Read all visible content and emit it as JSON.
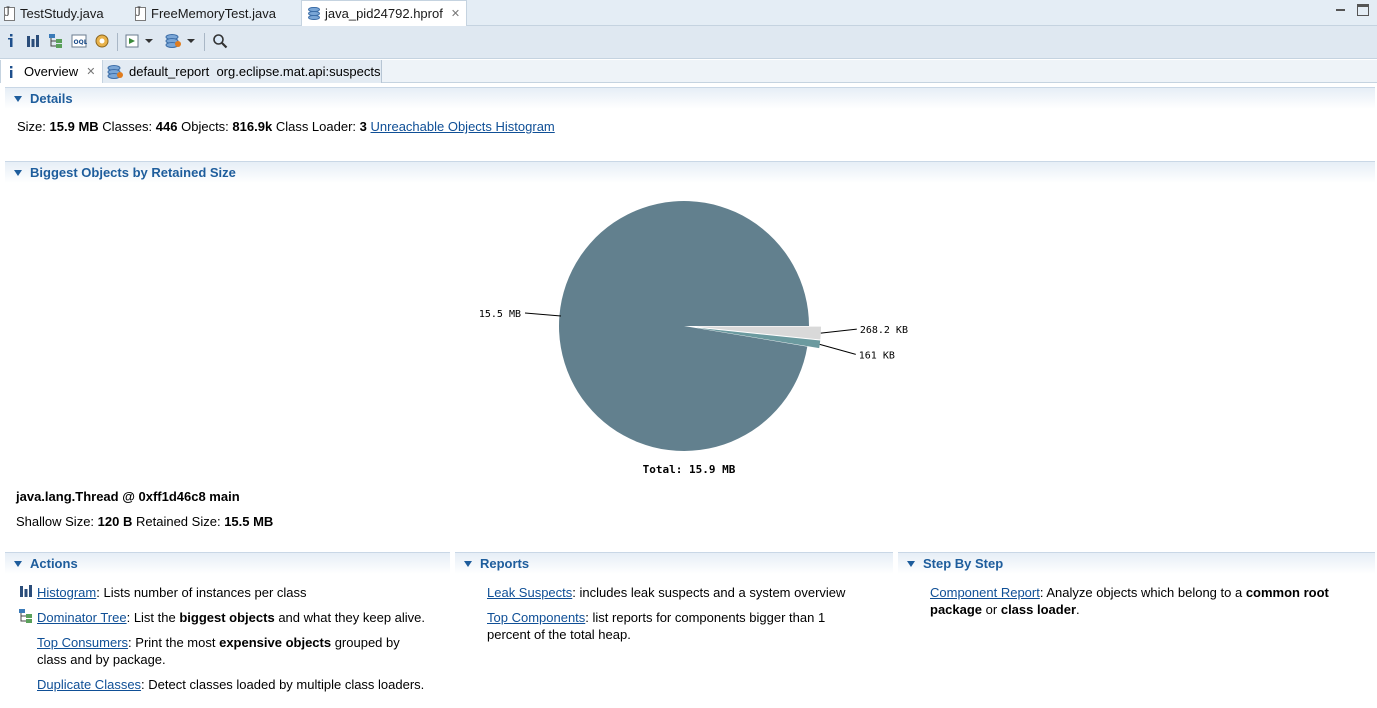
{
  "editor_tabs": [
    {
      "label": "TestStudy.java"
    },
    {
      "label": "FreeMemoryTest.java"
    },
    {
      "label": "java_pid24792.hprof"
    }
  ],
  "sub_tabs": {
    "overview": "Overview",
    "report": "default_report  org.eclipse.mat.api:suspects"
  },
  "details": {
    "title": "Details",
    "size_label": "Size:",
    "size_value": "15.9 MB",
    "classes_label": "Classes:",
    "classes_value": "446",
    "objects_label": "Objects:",
    "objects_value": "816.9k",
    "classloader_label": "Class Loader:",
    "classloader_value": "3",
    "unreachable_link": "Unreachable Objects Histogram"
  },
  "biggest": {
    "title": "Biggest Objects by Retained Size",
    "object_name": "java.lang.Thread @ 0xff1d46c8 main",
    "shallow_label": "Shallow Size:",
    "shallow_value": "120 B",
    "retained_label": "Retained Size:",
    "retained_value": "15.5 MB"
  },
  "chart_data": {
    "type": "pie",
    "slices": [
      {
        "label": "15.5 MB",
        "value": 15.5,
        "color": "#62808e"
      },
      {
        "label": "268.2 KB",
        "value": 0.262,
        "color": "#d9d9d9"
      },
      {
        "label": "161 KB",
        "value": 0.157,
        "color": "#6b9a9f"
      }
    ],
    "total_label": "Total: 15.9 MB"
  },
  "actions": {
    "title": "Actions",
    "items": [
      {
        "link": "Histogram",
        "text_before": ": Lists number of instances per class",
        "bold": "",
        "text_after": ""
      },
      {
        "link": "Dominator Tree",
        "text_before": ": List the ",
        "bold": "biggest objects",
        "text_after": " and what they keep alive."
      },
      {
        "link": "Top Consumers",
        "text_before": ": Print the most ",
        "bold": "expensive objects",
        "text_after": " grouped by class and by package."
      },
      {
        "link": "Duplicate Classes",
        "text_before": ": Detect classes loaded by multiple class loaders.",
        "bold": "",
        "text_after": ""
      }
    ]
  },
  "reports": {
    "title": "Reports",
    "items": [
      {
        "link": "Leak Suspects",
        "text": ": includes leak suspects and a system overview"
      },
      {
        "link": "Top Components",
        "text": ": list reports for components bigger than 1 percent of the total heap."
      }
    ]
  },
  "step": {
    "title": "Step By Step",
    "link": "Component Report",
    "text1": ": Analyze objects which belong to a ",
    "bold1": "common root package",
    "text2": " or ",
    "bold2": "class loader",
    "text3": "."
  }
}
